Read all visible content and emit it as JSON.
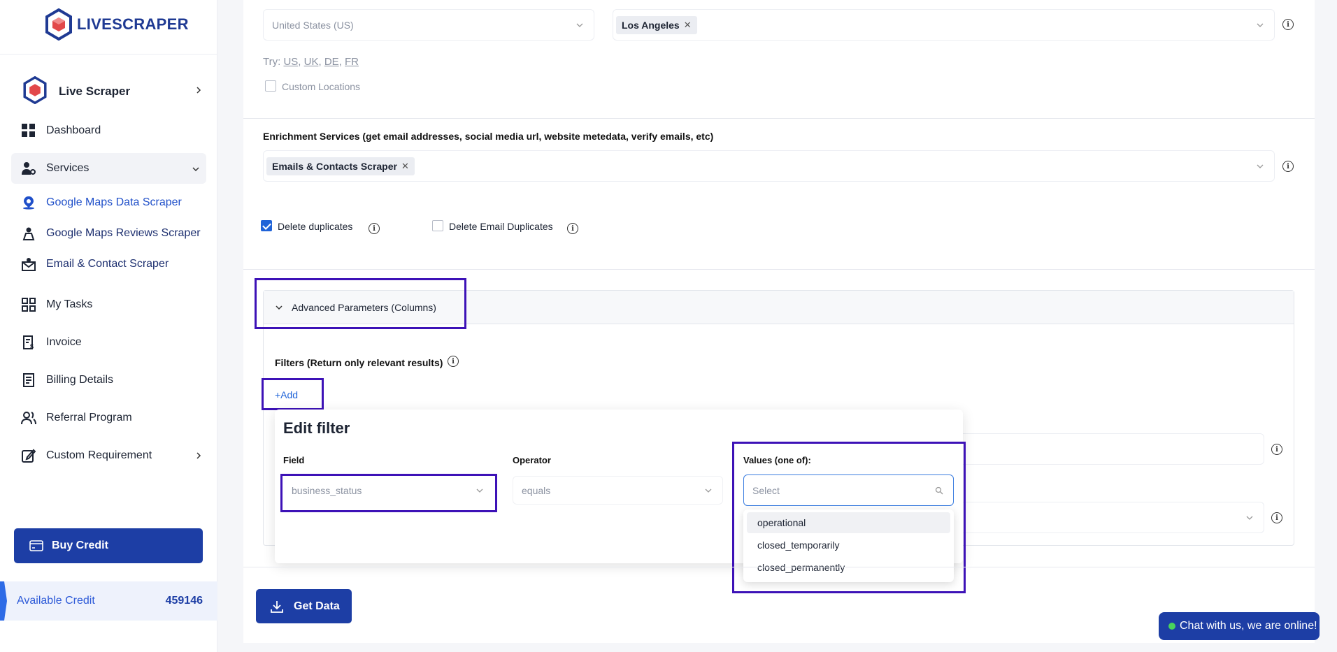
{
  "brand": {
    "logo_text": "LIVESCRAPER"
  },
  "sidebar": {
    "header": "Live Scraper",
    "items": [
      {
        "label": "Dashboard"
      },
      {
        "label": "Services"
      },
      {
        "label": "Google Maps Data Scraper"
      },
      {
        "label": "Google Maps Reviews Scraper"
      },
      {
        "label": "Email & Contact Scraper"
      },
      {
        "label": "My Tasks"
      },
      {
        "label": "Invoice"
      },
      {
        "label": "Billing Details"
      },
      {
        "label": "Referral Program"
      },
      {
        "label": "Custom Requirement"
      }
    ],
    "buy_credit": "Buy Credit",
    "credit_label": "Available Credit",
    "credit_value": "459146"
  },
  "location": {
    "country_placeholder": "United States (US)",
    "city_tag": "Los Angeles",
    "try_label": "Try:",
    "try_links": [
      "US",
      "UK",
      "DE",
      "FR"
    ],
    "custom_locations": "Custom Locations"
  },
  "enrichment": {
    "label": "Enrichment Services (get email addresses, social media url, website metedata, verify emails, etc)",
    "tag": "Emails & Contacts Scraper"
  },
  "options": {
    "delete_duplicates": "Delete duplicates",
    "delete_email_duplicates": "Delete Email Duplicates"
  },
  "advanced": {
    "title": "Advanced Parameters (Columns)",
    "filters_label": "Filters (Return only relevant results)",
    "add_label": "+Add"
  },
  "edit_filter": {
    "title": "Edit filter",
    "field_label": "Field",
    "field_value": "business_status",
    "operator_label": "Operator",
    "operator_value": "equals",
    "values_label": "Values (one of):",
    "values_placeholder": "Select",
    "options": [
      "operational",
      "closed_temporarily",
      "closed_permanently"
    ]
  },
  "get_data": "Get Data",
  "chat": "Chat with us, we are online!",
  "colors": {
    "primary": "#1d3ea5",
    "highlight": "#3d12b7",
    "link": "#1f4fc9"
  }
}
